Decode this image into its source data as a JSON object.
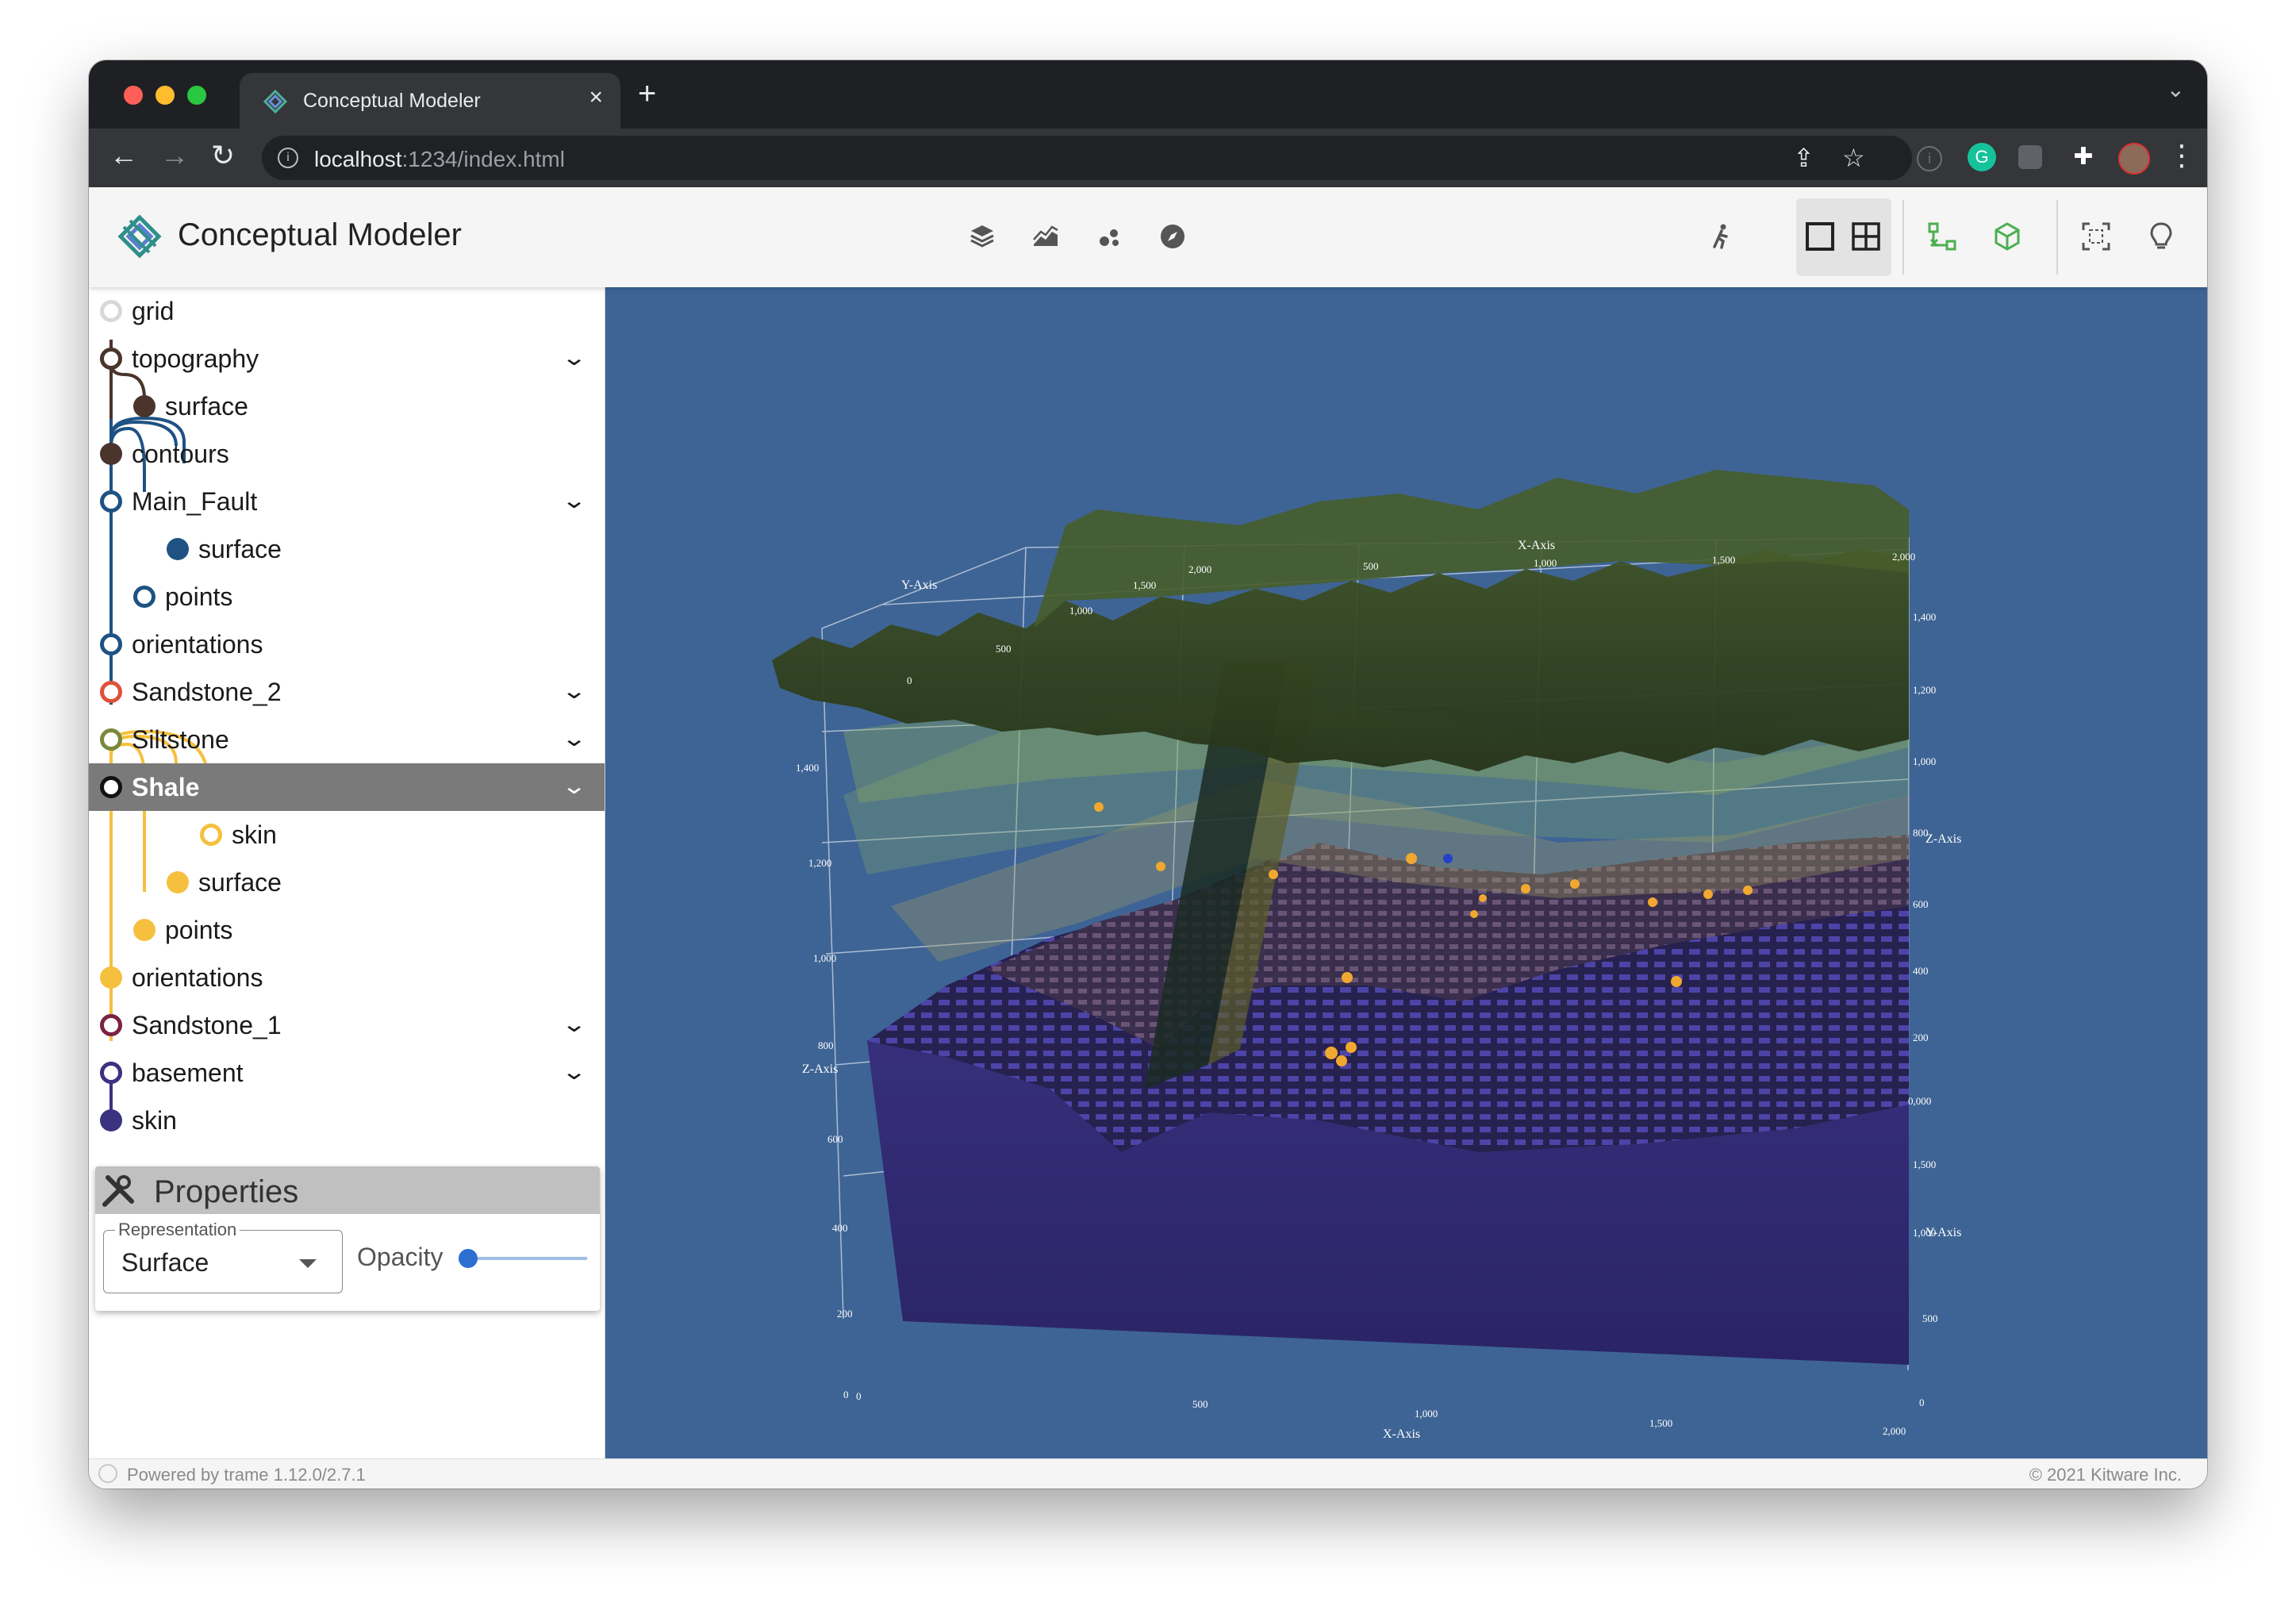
{
  "browser": {
    "tab_title": "Conceptual Modeler",
    "tab_close": "×",
    "new_tab": "+",
    "url_host": "localhost",
    "url_rest": ":1234/index.html",
    "back": "←",
    "forward": "→",
    "reload": "↻",
    "share": "⇪",
    "star": "☆",
    "menu": "⋮",
    "tab_menu": "⌄",
    "ext_grammarly": "G",
    "ext_puzzle": "✚"
  },
  "app": {
    "title": "Conceptual Modeler"
  },
  "tree": [
    {
      "label": "grid",
      "color": "#d8d8d8",
      "filled": false,
      "expand": ""
    },
    {
      "label": "topography",
      "color": "#4a342c",
      "filled": false,
      "expand": "⌄"
    },
    {
      "label": "surface",
      "color": "#4a342c",
      "filled": true,
      "expand": ""
    },
    {
      "label": "contours",
      "color": "#4a342c",
      "filled": true,
      "expand": ""
    },
    {
      "label": "Main_Fault",
      "color": "#1e5283",
      "filled": false,
      "expand": "⌄"
    },
    {
      "label": "surface",
      "color": "#1e5283",
      "filled": true,
      "expand": ""
    },
    {
      "label": "points",
      "color": "#1e5283",
      "filled": false,
      "expand": ""
    },
    {
      "label": "orientations",
      "color": "#1e5283",
      "filled": false,
      "expand": ""
    },
    {
      "label": "Sandstone_2",
      "color": "#e0513a",
      "filled": false,
      "expand": "⌄"
    },
    {
      "label": "Siltstone",
      "color": "#79883a",
      "filled": false,
      "expand": "⌄"
    },
    {
      "label": "Shale",
      "color": "#ffffff",
      "filled": false,
      "expand": "⌄"
    },
    {
      "label": "skin",
      "color": "#f5c03e",
      "filled": false,
      "expand": ""
    },
    {
      "label": "surface",
      "color": "#f5c03e",
      "filled": true,
      "expand": ""
    },
    {
      "label": "points",
      "color": "#f5c03e",
      "filled": true,
      "expand": ""
    },
    {
      "label": "orientations",
      "color": "#f5c03e",
      "filled": true,
      "expand": ""
    },
    {
      "label": "Sandstone_1",
      "color": "#7c2245",
      "filled": false,
      "expand": "⌄"
    },
    {
      "label": "basement",
      "color": "#3b3280",
      "filled": false,
      "expand": "⌄"
    },
    {
      "label": "skin",
      "color": "#3b3280",
      "filled": true,
      "expand": ""
    }
  ],
  "properties": {
    "title": "Properties",
    "representation_label": "Representation",
    "representation_value": "Surface",
    "opacity_label": "Opacity",
    "opacity_value": 0
  },
  "axes": {
    "x_title": "X-Axis",
    "y_title": "Y-Axis",
    "z_title": "Z-Axis",
    "top_x_ticks": [
      "2,000",
      "500",
      "1,000",
      "1,500",
      "2,000"
    ],
    "top_y_ticks": [
      "1,500",
      "1,000",
      "500",
      "0"
    ],
    "left_z_ticks": [
      "1,400",
      "1,200",
      "1,000",
      "800",
      "600",
      "400",
      "200",
      "0"
    ],
    "right_z_ticks": [
      "1,400",
      "1,200",
      "1,000",
      "800",
      "600",
      "400",
      "200",
      "0,000"
    ],
    "right_y_ticks": [
      "1,500",
      "1,000",
      "500",
      "0"
    ],
    "bottom_x_ticks": [
      "0",
      "500",
      "1,000",
      "1,500",
      "2,000"
    ]
  },
  "footer": {
    "left": "Powered by trame 1.12.0/2.7.1",
    "right": "© 2021 Kitware Inc."
  }
}
